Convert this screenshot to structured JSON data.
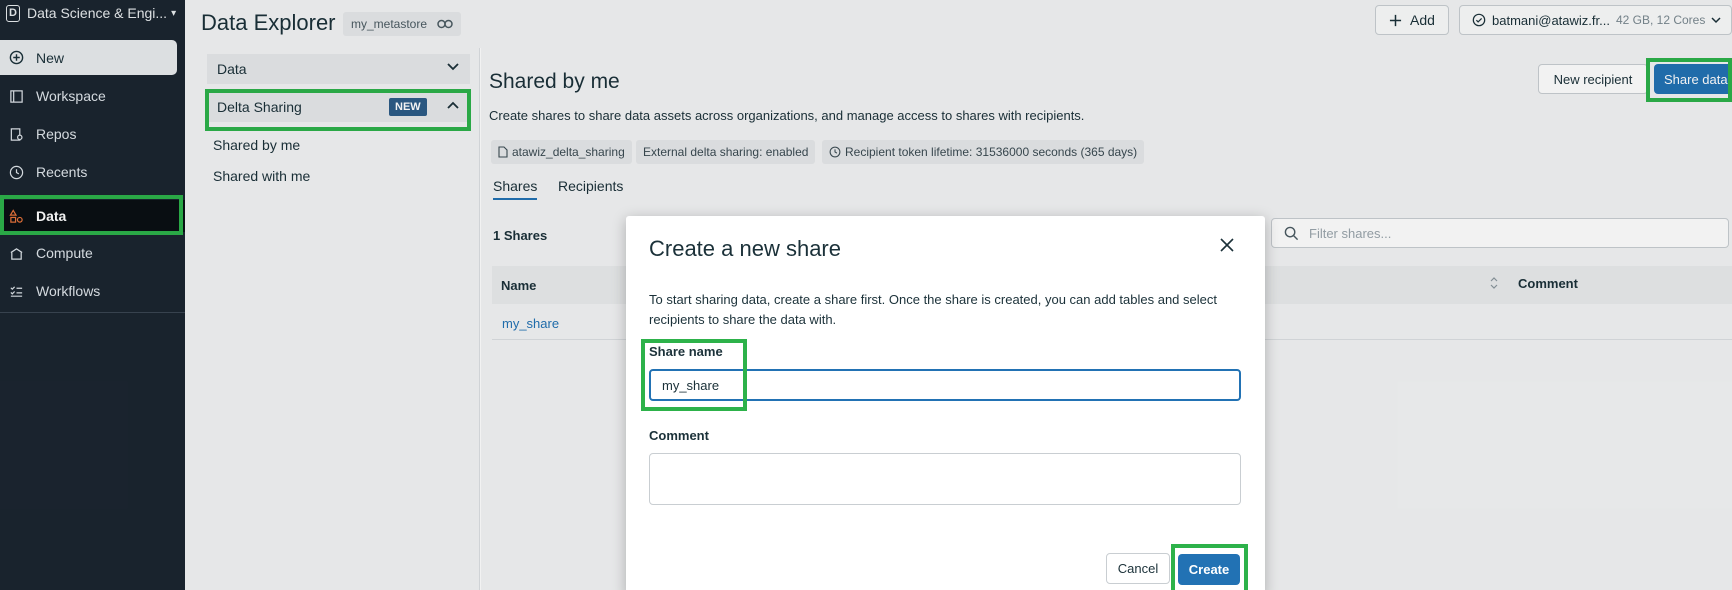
{
  "sidebar": {
    "workspace_label": "Data Science & Engi...",
    "workspace_logo": "D",
    "items": [
      {
        "label": "New",
        "icon": "plus-circle-icon"
      },
      {
        "label": "Workspace",
        "icon": "workspace-icon"
      },
      {
        "label": "Repos",
        "icon": "repos-icon"
      },
      {
        "label": "Recents",
        "icon": "clock-icon"
      },
      {
        "label": "Data",
        "icon": "data-icon"
      },
      {
        "label": "Compute",
        "icon": "compute-icon"
      },
      {
        "label": "Workflows",
        "icon": "workflows-icon"
      }
    ]
  },
  "header": {
    "title": "Data Explorer",
    "metastore": "my_metastore",
    "add_label": "Add",
    "cluster_name": "batmani@atawiz.fr...",
    "cluster_specs": "42 GB, 12 Cores"
  },
  "left_panel": {
    "data_label": "Data",
    "delta_sharing_label": "Delta Sharing",
    "new_badge": "NEW",
    "shared_by_me": "Shared by me",
    "shared_with_me": "Shared with me"
  },
  "main": {
    "title": "Shared by me",
    "description": "Create shares to share data assets across organizations, and manage access to shares with recipients.",
    "chips": [
      "atawiz_delta_sharing",
      "External delta sharing: enabled",
      "Recipient token lifetime: 31536000 seconds (365 days)"
    ],
    "tabs": [
      "Shares",
      "Recipients"
    ],
    "new_recipient_label": "New recipient",
    "share_data_label": "Share data",
    "shares_count": "1 Shares",
    "filter_placeholder": "Filter shares...",
    "columns": [
      "Name",
      "Comment"
    ],
    "rows": [
      {
        "name": "my_share"
      }
    ]
  },
  "modal": {
    "title": "Create a new share",
    "description": "To start sharing data, create a share first. Once the share is created, you can add tables and select recipients to share the data with.",
    "share_name_label": "Share name",
    "share_name_value": "my_share",
    "comment_label": "Comment",
    "cancel_label": "Cancel",
    "create_label": "Create"
  },
  "colors": {
    "sidebar_bg": "#1b2530",
    "accent": "#2272b4",
    "highlight": "#2db24a",
    "badge": "#2d5c87"
  }
}
